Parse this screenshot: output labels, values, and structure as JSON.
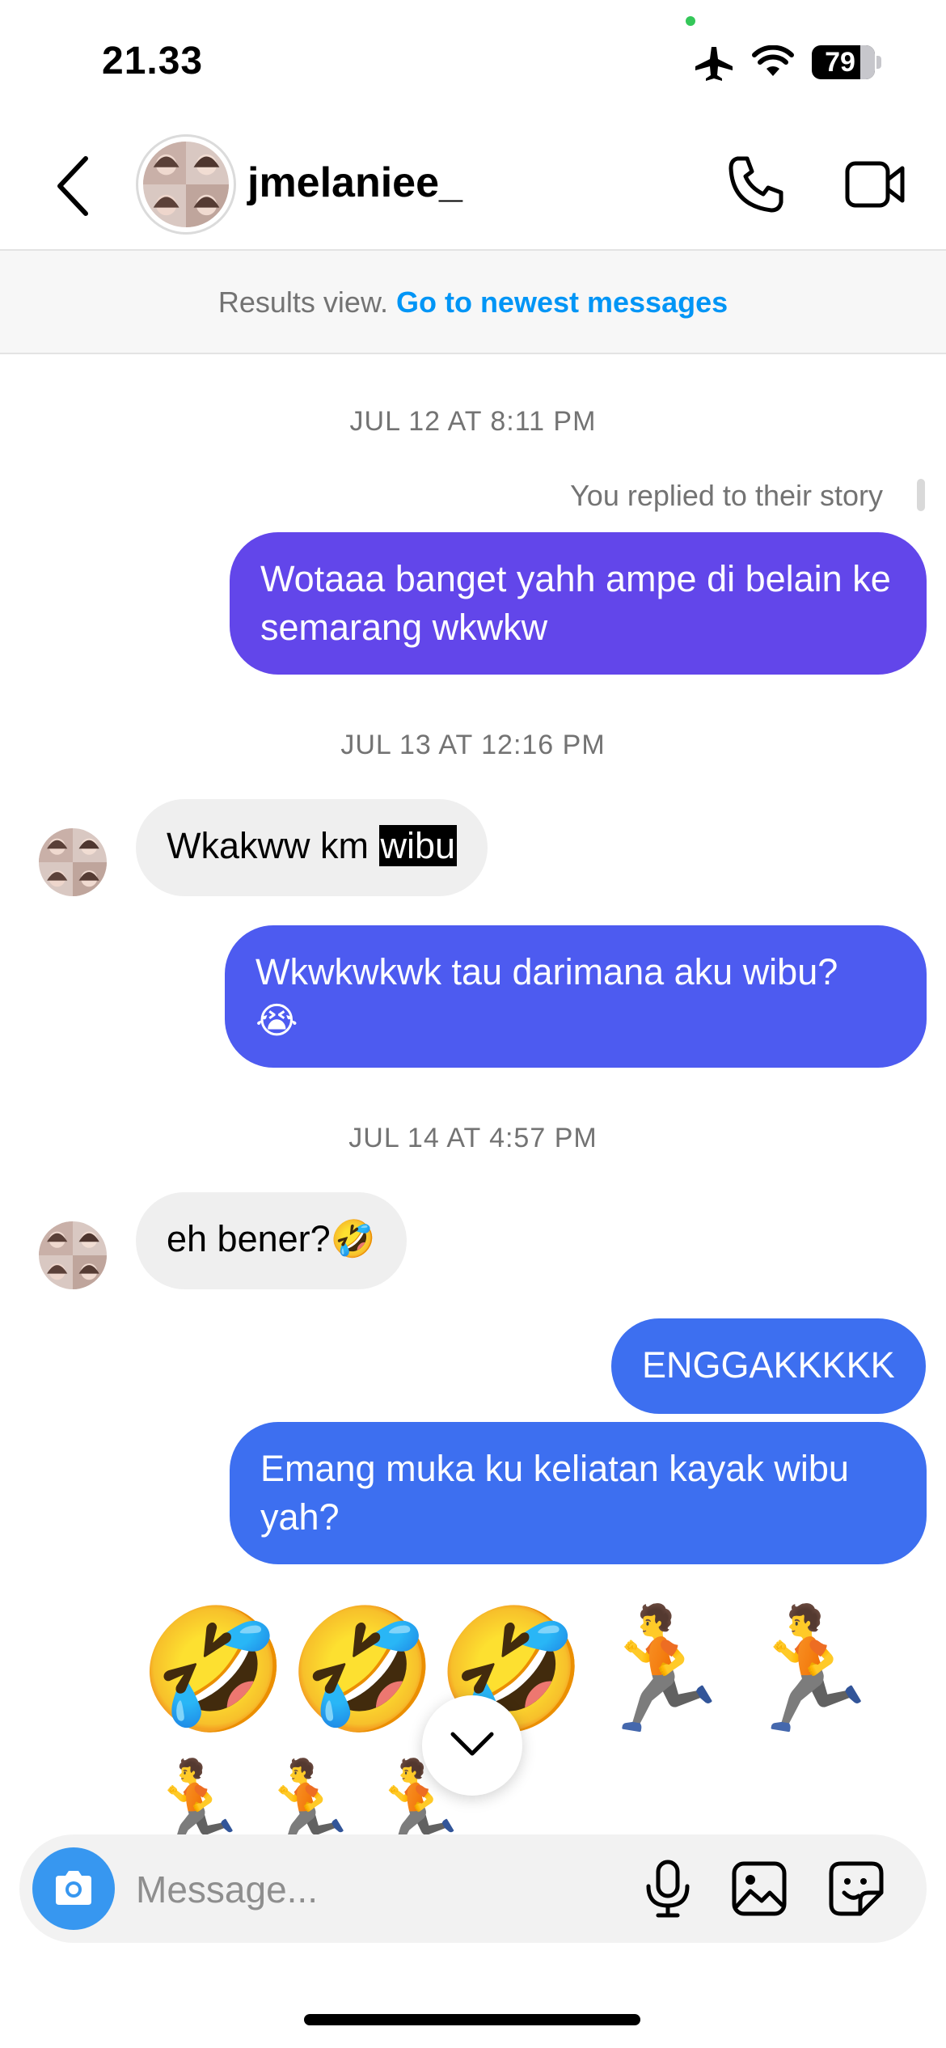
{
  "status_bar": {
    "time": "21.33",
    "battery": "79"
  },
  "header": {
    "username": "jmelaniee_"
  },
  "results_banner": {
    "text": "Results view.",
    "link": "Go to newest messages"
  },
  "thread": {
    "date_1": "JUL 12 AT 8:11 PM",
    "story_reply_note": "You replied to their story",
    "msg_1": "Wotaaa banget yahh ampe di belain ke semarang wkwkw",
    "date_2": "JUL 13 AT 12:16 PM",
    "msg_2_prefix": "Wkakww km",
    "msg_2_highlight": "wibu",
    "msg_3": "Wkwkwkwk tau darimana aku wibu?",
    "msg_3_emoji": "😭",
    "date_3": "JUL 14 AT 4:57 PM",
    "msg_4": "eh bener?🤣",
    "msg_5": "ENGGAKKKKK",
    "msg_6": "Emang muka ku keliatan kayak wibu yah?",
    "emoji_row_1": "🤣🤣🤣🏃🏃",
    "emoji_row_2": "🏃🏃🏃"
  },
  "composer": {
    "placeholder": "Message..."
  },
  "colors": {
    "bubble_purple": "#6246ea",
    "bubble_indigo": "#4d5bf0",
    "bubble_blue": "#3d6ff0",
    "link_blue": "#0095f6",
    "camera_blue": "#3797f0"
  },
  "icons": [
    "back-icon",
    "phone-icon",
    "video-icon",
    "airplane-icon",
    "wifi-icon",
    "battery-icon",
    "chevron-down-icon",
    "camera-icon",
    "mic-icon",
    "gallery-icon",
    "sticker-icon"
  ]
}
